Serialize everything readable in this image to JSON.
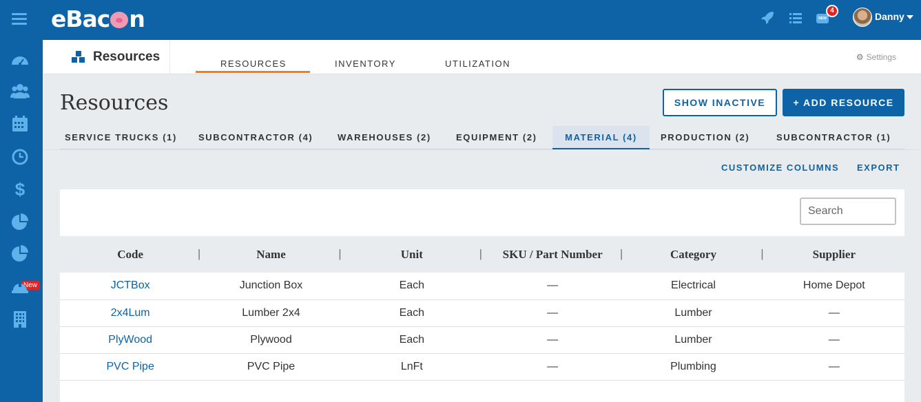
{
  "app": {
    "brand": "eBacon",
    "notifications_count": "4",
    "new_badge": "NEW",
    "user_name": "Danny"
  },
  "sidebar": {
    "items": [
      {
        "icon": "dashboard-icon"
      },
      {
        "icon": "users-icon"
      },
      {
        "icon": "calendar-icon"
      },
      {
        "icon": "clock-icon"
      },
      {
        "icon": "dollar-icon"
      },
      {
        "icon": "pie-chart-icon"
      },
      {
        "icon": "reports-icon",
        "badge": "New"
      },
      {
        "icon": "hard-hat-icon"
      },
      {
        "icon": "building-icon"
      }
    ]
  },
  "subheader": {
    "module_title": "Resources",
    "tabs": [
      "RESOURCES",
      "INVENTORY",
      "UTILIZATION"
    ],
    "active_tab": "RESOURCES",
    "settings_label": "Settings"
  },
  "page": {
    "title": "Resources",
    "show_inactive_label": "SHOW INACTIVE",
    "add_resource_label": "+ ADD RESOURCE",
    "customize_columns_label": "CUSTOMIZE COLUMNS",
    "export_label": "EXPORT"
  },
  "category_tabs": [
    "SERVICE TRUCKS (1)",
    "SUBCONTRACTOR (4)",
    "WAREHOUSES (2)",
    "EQUIPMENT (2)",
    "MATERIAL (4)",
    "PRODUCTION (2)",
    "SUBCONTRACTOR (1)"
  ],
  "active_category": "MATERIAL (4)",
  "table": {
    "search_placeholder": "Search",
    "columns": [
      "Code",
      "Name",
      "Unit",
      "SKU / Part Number",
      "Category",
      "Supplier"
    ],
    "rows": [
      [
        "JCTBox",
        "Junction Box",
        "Each",
        "—",
        "Electrical",
        "Home Depot"
      ],
      [
        "2x4Lum",
        "Lumber 2x4",
        "Each",
        "—",
        "Lumber",
        "—"
      ],
      [
        "PlyWood",
        "Plywood",
        "Each",
        "—",
        "Lumber",
        "—"
      ],
      [
        "PVC Pipe",
        "PVC Pipe",
        "LnFt",
        "—",
        "Plumbing",
        "—"
      ]
    ]
  },
  "colors": {
    "brand_blue": "#0d63a6",
    "accent_orange": "#f47b20",
    "badge_red": "#e02424"
  }
}
